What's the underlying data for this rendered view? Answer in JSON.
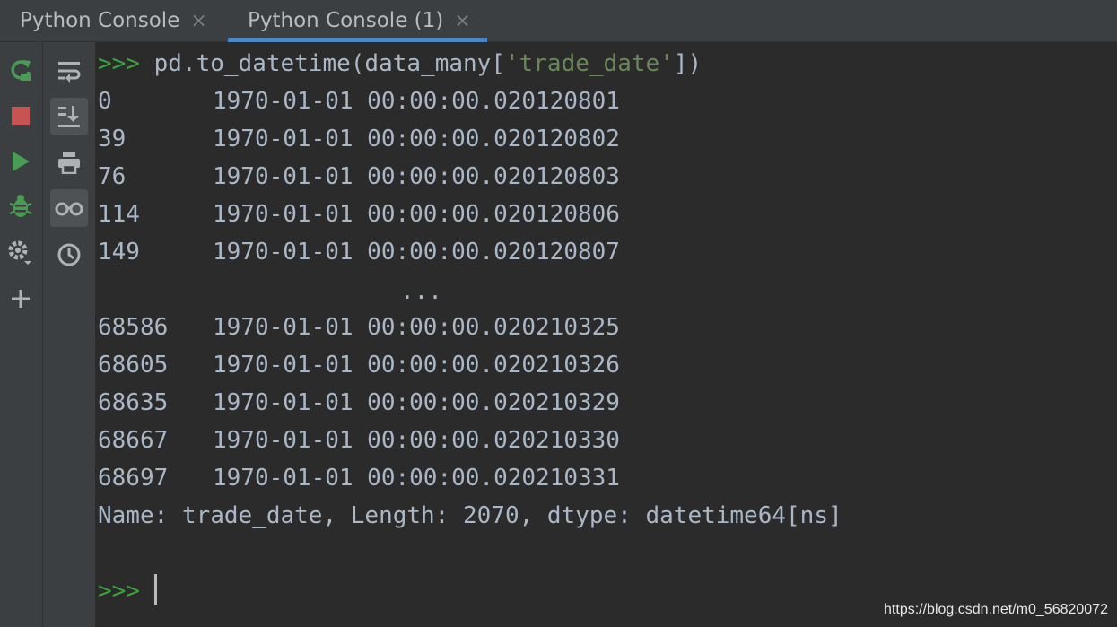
{
  "tabs": [
    {
      "label": "Python Console",
      "active": false
    },
    {
      "label": "Python Console (1)",
      "active": true
    }
  ],
  "tab_close_glyph": "×",
  "left_toolbar": [
    {
      "icon": "rerun-icon",
      "color": "#499c54"
    },
    {
      "icon": "stop-icon",
      "color": "#c75450"
    },
    {
      "icon": "execute-icon",
      "color": "#499c54"
    },
    {
      "icon": "debug-icon",
      "color": "#499c54"
    },
    {
      "icon": "settings-icon",
      "color": "#afb1b3"
    },
    {
      "icon": "add-icon",
      "color": "#afb1b3"
    }
  ],
  "right_toolbar": [
    {
      "icon": "soft-wrap-icon",
      "selected": false
    },
    {
      "icon": "scroll-to-end-icon",
      "selected": true
    },
    {
      "icon": "print-icon",
      "selected": false
    },
    {
      "icon": "show-variables-icon",
      "selected": true
    },
    {
      "icon": "history-icon",
      "selected": false
    }
  ],
  "console": {
    "prompt": ">>> ",
    "command_prefix": "pd.to_datetime(data_many[",
    "command_string": "'trade_date'",
    "command_suffix": "])",
    "rows_head": [
      {
        "index": "0",
        "value": "1970-01-01 00:00:00.020120801"
      },
      {
        "index": "39",
        "value": "1970-01-01 00:00:00.020120802"
      },
      {
        "index": "76",
        "value": "1970-01-01 00:00:00.020120803"
      },
      {
        "index": "114",
        "value": "1970-01-01 00:00:00.020120806"
      },
      {
        "index": "149",
        "value": "1970-01-01 00:00:00.020120807"
      }
    ],
    "ellipsis": "...",
    "rows_tail": [
      {
        "index": "68586",
        "value": "1970-01-01 00:00:00.020210325"
      },
      {
        "index": "68605",
        "value": "1970-01-01 00:00:00.020210326"
      },
      {
        "index": "68635",
        "value": "1970-01-01 00:00:00.020210329"
      },
      {
        "index": "68667",
        "value": "1970-01-01 00:00:00.020210330"
      },
      {
        "index": "68697",
        "value": "1970-01-01 00:00:00.020210331"
      }
    ],
    "summary": "Name: trade_date, Length: 2070, dtype: datetime64[ns]",
    "input_prompt": ">>> "
  },
  "watermark": "https://blog.csdn.net/m0_56820072",
  "colors": {
    "background": "#2b2b2b",
    "panel": "#3c3f41",
    "text": "#a9b7c6",
    "prompt": "#3fa03f",
    "string": "#6a8759",
    "tab_underline": "#4a88c7"
  }
}
